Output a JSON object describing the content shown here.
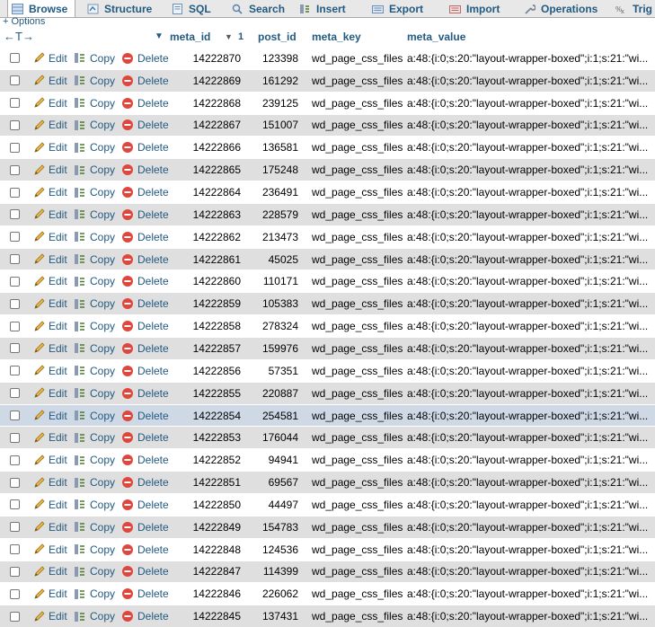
{
  "tabs": [
    {
      "label": "Browse",
      "icon": "table-icon",
      "active": true
    },
    {
      "label": "Structure",
      "icon": "structure-icon"
    },
    {
      "label": "SQL",
      "icon": "sql-icon"
    },
    {
      "label": "Search",
      "icon": "search-icon"
    },
    {
      "label": "Insert",
      "icon": "insert-icon"
    },
    {
      "label": "Export",
      "icon": "export-icon"
    },
    {
      "label": "Import",
      "icon": "import-icon"
    },
    {
      "label": "Operations",
      "icon": "wrench-icon"
    },
    {
      "label": "Trig",
      "icon": "triggers-icon"
    }
  ],
  "options_label": "+ Options",
  "column_toggle": "←T→",
  "headers": {
    "meta_id": "meta_id",
    "sort_indicator": "1",
    "post_id": "post_id",
    "meta_key": "meta_key",
    "meta_value": "meta_value"
  },
  "actions": {
    "edit": "Edit",
    "copy": "Copy",
    "delete": "Delete"
  },
  "highlighted_row": 16,
  "rows": [
    {
      "meta_id": "14222870",
      "post_id": "123398",
      "meta_key": "wd_page_css_files",
      "meta_value": "a:48:{i:0;s:20:\"layout-wrapper-boxed\";i:1;s:21:\"wi..."
    },
    {
      "meta_id": "14222869",
      "post_id": "161292",
      "meta_key": "wd_page_css_files",
      "meta_value": "a:48:{i:0;s:20:\"layout-wrapper-boxed\";i:1;s:21:\"wi..."
    },
    {
      "meta_id": "14222868",
      "post_id": "239125",
      "meta_key": "wd_page_css_files",
      "meta_value": "a:48:{i:0;s:20:\"layout-wrapper-boxed\";i:1;s:21:\"wi..."
    },
    {
      "meta_id": "14222867",
      "post_id": "151007",
      "meta_key": "wd_page_css_files",
      "meta_value": "a:48:{i:0;s:20:\"layout-wrapper-boxed\";i:1;s:21:\"wi..."
    },
    {
      "meta_id": "14222866",
      "post_id": "136581",
      "meta_key": "wd_page_css_files",
      "meta_value": "a:48:{i:0;s:20:\"layout-wrapper-boxed\";i:1;s:21:\"wi..."
    },
    {
      "meta_id": "14222865",
      "post_id": "175248",
      "meta_key": "wd_page_css_files",
      "meta_value": "a:48:{i:0;s:20:\"layout-wrapper-boxed\";i:1;s:21:\"wi..."
    },
    {
      "meta_id": "14222864",
      "post_id": "236491",
      "meta_key": "wd_page_css_files",
      "meta_value": "a:48:{i:0;s:20:\"layout-wrapper-boxed\";i:1;s:21:\"wi..."
    },
    {
      "meta_id": "14222863",
      "post_id": "228579",
      "meta_key": "wd_page_css_files",
      "meta_value": "a:48:{i:0;s:20:\"layout-wrapper-boxed\";i:1;s:21:\"wi..."
    },
    {
      "meta_id": "14222862",
      "post_id": "213473",
      "meta_key": "wd_page_css_files",
      "meta_value": "a:48:{i:0;s:20:\"layout-wrapper-boxed\";i:1;s:21:\"wi..."
    },
    {
      "meta_id": "14222861",
      "post_id": "45025",
      "meta_key": "wd_page_css_files",
      "meta_value": "a:48:{i:0;s:20:\"layout-wrapper-boxed\";i:1;s:21:\"wi..."
    },
    {
      "meta_id": "14222860",
      "post_id": "110171",
      "meta_key": "wd_page_css_files",
      "meta_value": "a:48:{i:0;s:20:\"layout-wrapper-boxed\";i:1;s:21:\"wi..."
    },
    {
      "meta_id": "14222859",
      "post_id": "105383",
      "meta_key": "wd_page_css_files",
      "meta_value": "a:48:{i:0;s:20:\"layout-wrapper-boxed\";i:1;s:21:\"wi..."
    },
    {
      "meta_id": "14222858",
      "post_id": "278324",
      "meta_key": "wd_page_css_files",
      "meta_value": "a:48:{i:0;s:20:\"layout-wrapper-boxed\";i:1;s:21:\"wi..."
    },
    {
      "meta_id": "14222857",
      "post_id": "159976",
      "meta_key": "wd_page_css_files",
      "meta_value": "a:48:{i:0;s:20:\"layout-wrapper-boxed\";i:1;s:21:\"wi..."
    },
    {
      "meta_id": "14222856",
      "post_id": "57351",
      "meta_key": "wd_page_css_files",
      "meta_value": "a:48:{i:0;s:20:\"layout-wrapper-boxed\";i:1;s:21:\"wi..."
    },
    {
      "meta_id": "14222855",
      "post_id": "220887",
      "meta_key": "wd_page_css_files",
      "meta_value": "a:48:{i:0;s:20:\"layout-wrapper-boxed\";i:1;s:21:\"wi..."
    },
    {
      "meta_id": "14222854",
      "post_id": "254581",
      "meta_key": "wd_page_css_files",
      "meta_value": "a:48:{i:0;s:20:\"layout-wrapper-boxed\";i:1;s:21:\"wi..."
    },
    {
      "meta_id": "14222853",
      "post_id": "176044",
      "meta_key": "wd_page_css_files",
      "meta_value": "a:48:{i:0;s:20:\"layout-wrapper-boxed\";i:1;s:21:\"wi..."
    },
    {
      "meta_id": "14222852",
      "post_id": "94941",
      "meta_key": "wd_page_css_files",
      "meta_value": "a:48:{i:0;s:20:\"layout-wrapper-boxed\";i:1;s:21:\"wi..."
    },
    {
      "meta_id": "14222851",
      "post_id": "69567",
      "meta_key": "wd_page_css_files",
      "meta_value": "a:48:{i:0;s:20:\"layout-wrapper-boxed\";i:1;s:21:\"wi..."
    },
    {
      "meta_id": "14222850",
      "post_id": "44497",
      "meta_key": "wd_page_css_files",
      "meta_value": "a:48:{i:0;s:20:\"layout-wrapper-boxed\";i:1;s:21:\"wi..."
    },
    {
      "meta_id": "14222849",
      "post_id": "154783",
      "meta_key": "wd_page_css_files",
      "meta_value": "a:48:{i:0;s:20:\"layout-wrapper-boxed\";i:1;s:21:\"wi..."
    },
    {
      "meta_id": "14222848",
      "post_id": "124536",
      "meta_key": "wd_page_css_files",
      "meta_value": "a:48:{i:0;s:20:\"layout-wrapper-boxed\";i:1;s:21:\"wi..."
    },
    {
      "meta_id": "14222847",
      "post_id": "114399",
      "meta_key": "wd_page_css_files",
      "meta_value": "a:48:{i:0;s:20:\"layout-wrapper-boxed\";i:1;s:21:\"wi..."
    },
    {
      "meta_id": "14222846",
      "post_id": "226062",
      "meta_key": "wd_page_css_files",
      "meta_value": "a:48:{i:0;s:20:\"layout-wrapper-boxed\";i:1;s:21:\"wi..."
    },
    {
      "meta_id": "14222845",
      "post_id": "137431",
      "meta_key": "wd_page_css_files",
      "meta_value": "a:48:{i:0;s:20:\"layout-wrapper-boxed\";i:1;s:21:\"wi..."
    }
  ]
}
